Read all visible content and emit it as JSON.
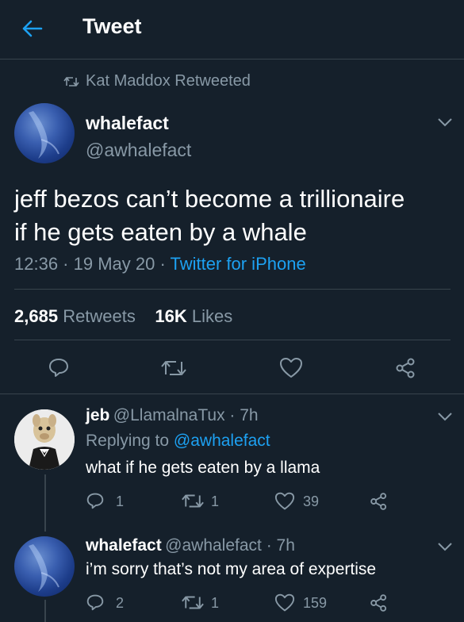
{
  "header": {
    "title": "Tweet",
    "back_icon": "back-arrow-icon"
  },
  "retweet_banner": {
    "text": "Kat Maddox Retweeted",
    "icon": "retweet-icon"
  },
  "main_tweet": {
    "name": "whalefact",
    "handle": "@awhalefact",
    "text_line1": "jeff bezos can’t become a trillionaire",
    "text_line2": "if he gets eaten by a whale",
    "time": "12:36 · 19 May 20 · ",
    "source": "Twitter for iPhone",
    "retweets_count": "2,685",
    "retweets_label": "Retweets",
    "likes_count": "16K",
    "likes_label": "Likes"
  },
  "replies": [
    {
      "name": "jeb",
      "handle_time": "@LlamalnaTux · 7h",
      "replying_prefix": "Replying to ",
      "replying_to": "@awhalefact",
      "text": "what if he gets eaten by a llama",
      "reply_count": "1",
      "retweet_count": "1",
      "like_count": "39"
    },
    {
      "name": "whalefact",
      "handle_time": "@awhalefact · 7h",
      "text": "i’m sorry that’s not my area of expertise",
      "reply_count": "2",
      "retweet_count": "1",
      "like_count": "159"
    }
  ],
  "colors": {
    "background": "#15202b",
    "accent": "#1da1f2",
    "secondary_text": "#8899a6",
    "divider": "#38444d"
  }
}
